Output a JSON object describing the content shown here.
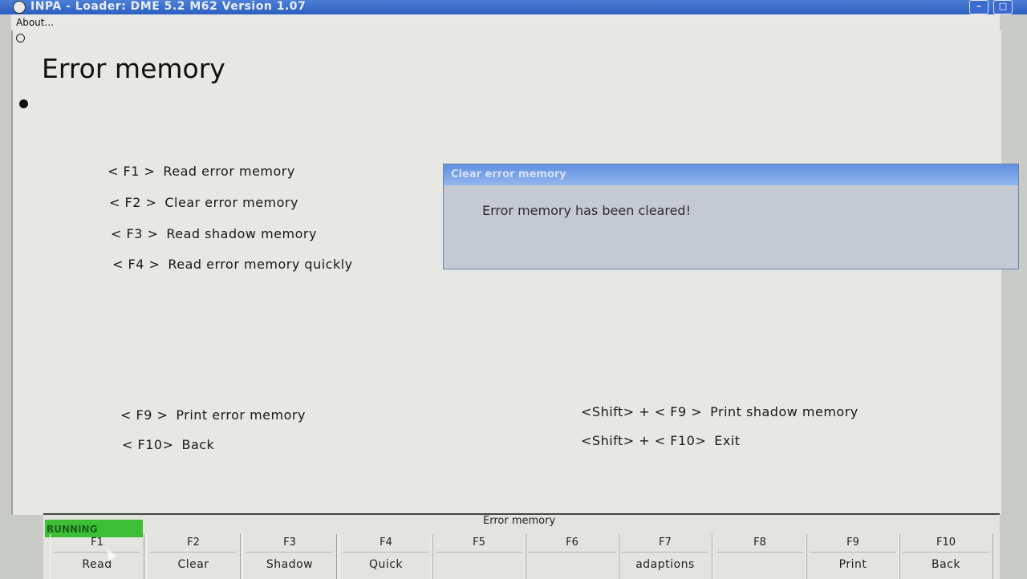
{
  "window": {
    "title": "INPA - Loader:  DME 5.2 M62 Version 1.07"
  },
  "menu": {
    "about": "About..."
  },
  "page": {
    "title": "Error memory"
  },
  "options": [
    {
      "key": "< F1 >",
      "label": "Read error memory"
    },
    {
      "key": "< F2 >",
      "label": "Clear error memory"
    },
    {
      "key": "< F3 >",
      "label": "Read shadow memory"
    },
    {
      "key": "< F4 >",
      "label": "Read error memory quickly"
    },
    {
      "key": "< F9 >",
      "label": "Print error memory"
    },
    {
      "key": "< F10>",
      "label": "Back"
    },
    {
      "key": "<Shift> + < F9 >",
      "label": "Print shadow memory"
    },
    {
      "key": "<Shift> + < F10>",
      "label": "Exit"
    }
  ],
  "dialog": {
    "title": "Clear error memory",
    "message": "Error memory has been cleared!"
  },
  "status": {
    "running": "RUNNING",
    "text": "Error memory",
    "running_color": "#3bbf34"
  },
  "fkeys": [
    {
      "name": "F1",
      "label": "Read"
    },
    {
      "name": "F2",
      "label": "Clear"
    },
    {
      "name": "F3",
      "label": "Shadow"
    },
    {
      "name": "F4",
      "label": "Quick"
    },
    {
      "name": "F5",
      "label": ""
    },
    {
      "name": "F6",
      "label": ""
    },
    {
      "name": "F7",
      "label": "adaptions"
    },
    {
      "name": "F8",
      "label": ""
    },
    {
      "name": "F9",
      "label": "Print"
    },
    {
      "name": "F10",
      "label": "Back"
    }
  ]
}
